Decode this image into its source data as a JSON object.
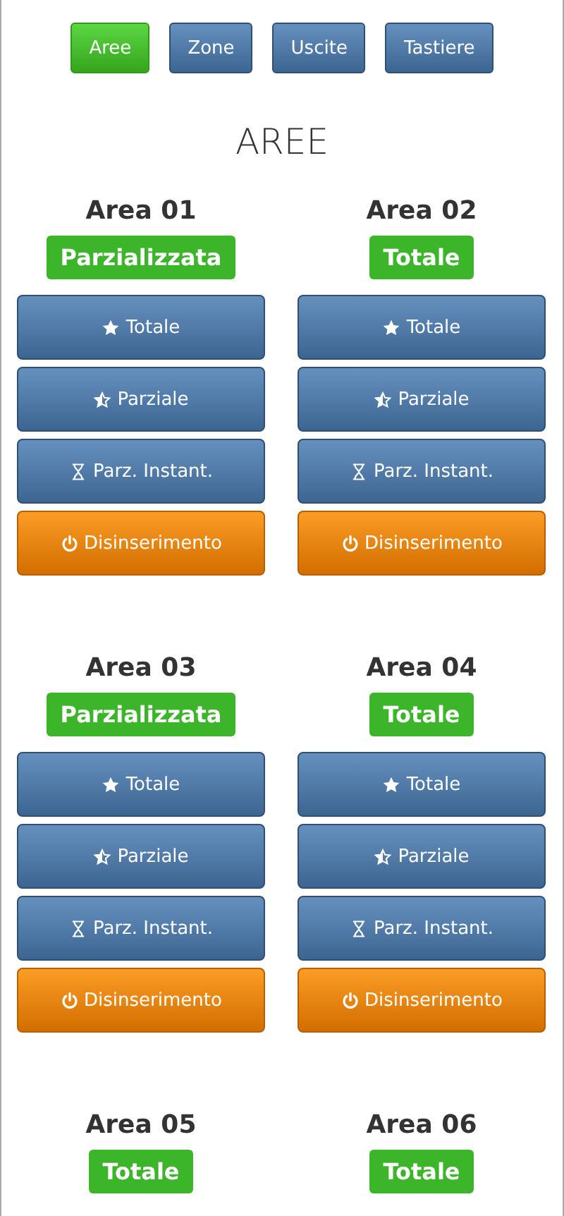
{
  "tabs": [
    {
      "label": "Aree",
      "selected": true
    },
    {
      "label": "Zone",
      "selected": false
    },
    {
      "label": "Uscite",
      "selected": false
    },
    {
      "label": "Tastiere",
      "selected": false
    }
  ],
  "title": "AREE",
  "areas": [
    {
      "name": "Area 01",
      "status": "Parzializzata",
      "actions": [
        {
          "kind": "star",
          "label": "Totale"
        },
        {
          "kind": "half-star",
          "label": "Parziale"
        },
        {
          "kind": "hourglass",
          "label": "Parz. Instant."
        },
        {
          "kind": "power",
          "label": "Disinserimento"
        }
      ]
    },
    {
      "name": "Area 02",
      "status": "Totale",
      "actions": [
        {
          "kind": "star",
          "label": "Totale"
        },
        {
          "kind": "half-star",
          "label": "Parziale"
        },
        {
          "kind": "hourglass",
          "label": "Parz. Instant."
        },
        {
          "kind": "power",
          "label": "Disinserimento"
        }
      ]
    },
    {
      "name": "Area 03",
      "status": "Parzializzata",
      "actions": [
        {
          "kind": "star",
          "label": "Totale"
        },
        {
          "kind": "half-star",
          "label": "Parziale"
        },
        {
          "kind": "hourglass",
          "label": "Parz. Instant."
        },
        {
          "kind": "power",
          "label": "Disinserimento"
        }
      ]
    },
    {
      "name": "Area 04",
      "status": "Totale",
      "actions": [
        {
          "kind": "star",
          "label": "Totale"
        },
        {
          "kind": "half-star",
          "label": "Parziale"
        },
        {
          "kind": "hourglass",
          "label": "Parz. Instant."
        },
        {
          "kind": "power",
          "label": "Disinserimento"
        }
      ]
    },
    {
      "name": "Area 05",
      "status": "Totale"
    },
    {
      "name": "Area 06",
      "status": "Totale"
    }
  ]
}
